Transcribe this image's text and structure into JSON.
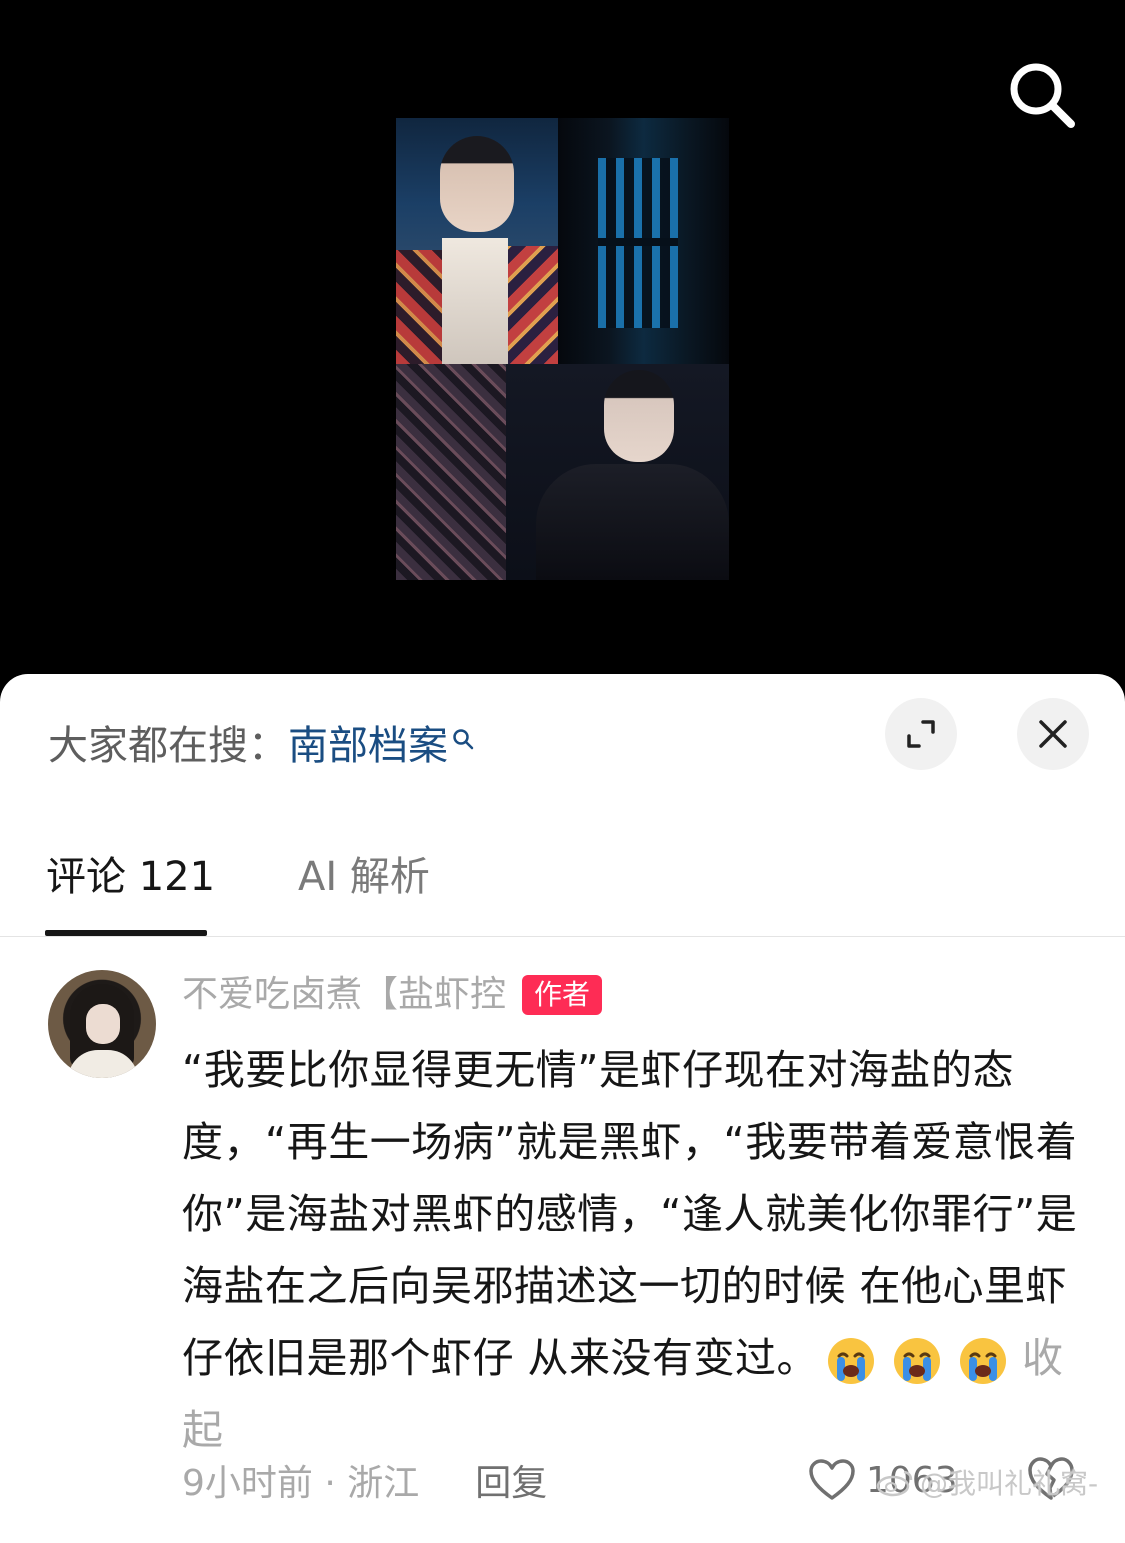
{
  "video": {},
  "panel": {
    "trending_prefix": "大家都在搜：",
    "trending_query": "南部档案"
  },
  "tabs": [
    {
      "label": "评论 121",
      "active": true
    },
    {
      "label": "AI 解析",
      "active": false
    }
  ],
  "comment": {
    "username": "不爱吃卤煮【盐虾控",
    "badge": "作者",
    "text": "“我要比你显得更无情”是虾仔现在对海盐的态度，“再生一场病”就是黑虾，“我要带着爱意恨着你”是海盐对黑虾的感情，“逢人就美化你罪行”是海盐在之后向吴邪描述这一切的时候 在他心里虾仔依旧是那个虾仔 从来没有变过。",
    "emojis": [
      "crying-emoji",
      "crying-emoji",
      "crying-emoji"
    ],
    "collapse_label": "收起",
    "meta": "9小时前 · 浙江",
    "reply_label": "回复",
    "likes": "1063"
  },
  "watermark": "@我叫礼礼窝-",
  "colors": {
    "accent_red": "#fe2c55",
    "link_blue": "#1a4d82",
    "muted_text": "#a9a9a9"
  }
}
